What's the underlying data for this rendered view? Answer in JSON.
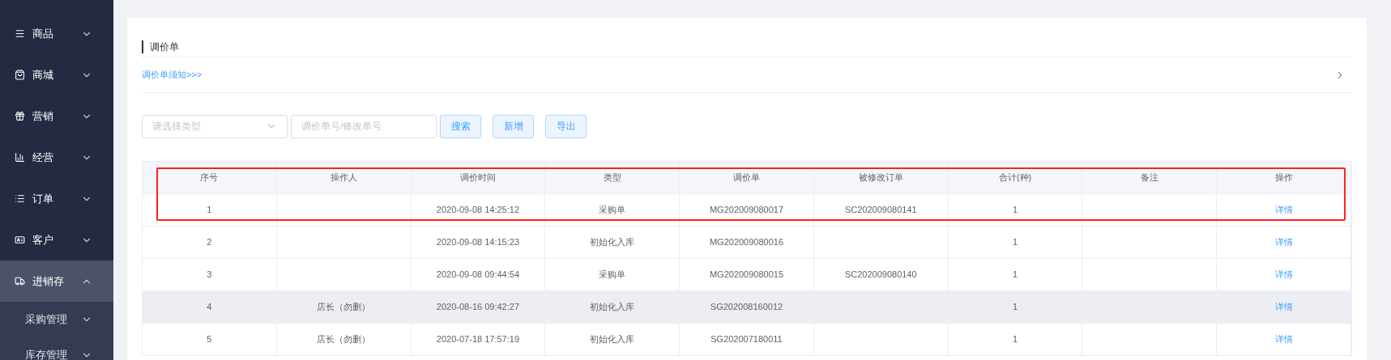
{
  "sidebar": {
    "items": [
      {
        "label": "商品",
        "expanded": false,
        "selected": false
      },
      {
        "label": "商城",
        "expanded": false,
        "selected": false
      },
      {
        "label": "营销",
        "expanded": false,
        "selected": false
      },
      {
        "label": "经营",
        "expanded": false,
        "selected": false
      },
      {
        "label": "订单",
        "expanded": false,
        "selected": false
      },
      {
        "label": "客户",
        "expanded": false,
        "selected": false
      },
      {
        "label": "进销存",
        "expanded": true,
        "selected": true,
        "children": [
          {
            "label": "采购管理",
            "expanded": false
          },
          {
            "label": "库存管理",
            "expanded": false
          }
        ]
      }
    ]
  },
  "page": {
    "title": "调价单",
    "notice_link": "调价单须知>>>",
    "filters": {
      "type_select": {
        "placeholder": "请选择类型"
      },
      "search_field": {
        "placeholder": "调价单号/修改单号"
      },
      "buttons": [
        "搜索",
        "新增",
        "导出"
      ]
    },
    "table": {
      "header_and_first_row_framed": true,
      "columns": [
        "序号",
        "操作人",
        "调价时间",
        "类型",
        "调价单",
        "被修改订单",
        "合计(种)",
        "备注",
        "操作"
      ],
      "rows": [
        {
          "cells": [
            "1",
            "",
            "2020-09-08 14:25:12",
            "采购单",
            "MG202009080017",
            "SC202009080141",
            "1",
            "",
            "详情"
          ],
          "shaded": false
        },
        {
          "cells": [
            "2",
            "",
            "2020-09-08 14:15:23",
            "初始化入库",
            "MG202009080016",
            "",
            "1",
            "",
            "详情"
          ],
          "shaded": false
        },
        {
          "cells": [
            "3",
            "",
            "2020-09-08 09:44:54",
            "采购单",
            "MG202009080015",
            "SC202009080140",
            "1",
            "",
            "详情"
          ],
          "shaded": false
        },
        {
          "cells": [
            "4",
            "店长（勿删）",
            "2020-08-16 09:42:27",
            "初始化入库",
            "SG202008160012",
            "",
            "1",
            "",
            "详情"
          ],
          "shaded": true
        },
        {
          "cells": [
            "5",
            "店长（勿删）",
            "2020-07-18 17:57:19",
            "初始化入库",
            "SG202007180011",
            "",
            "1",
            "",
            "详情"
          ],
          "shaded": false
        }
      ]
    }
  }
}
